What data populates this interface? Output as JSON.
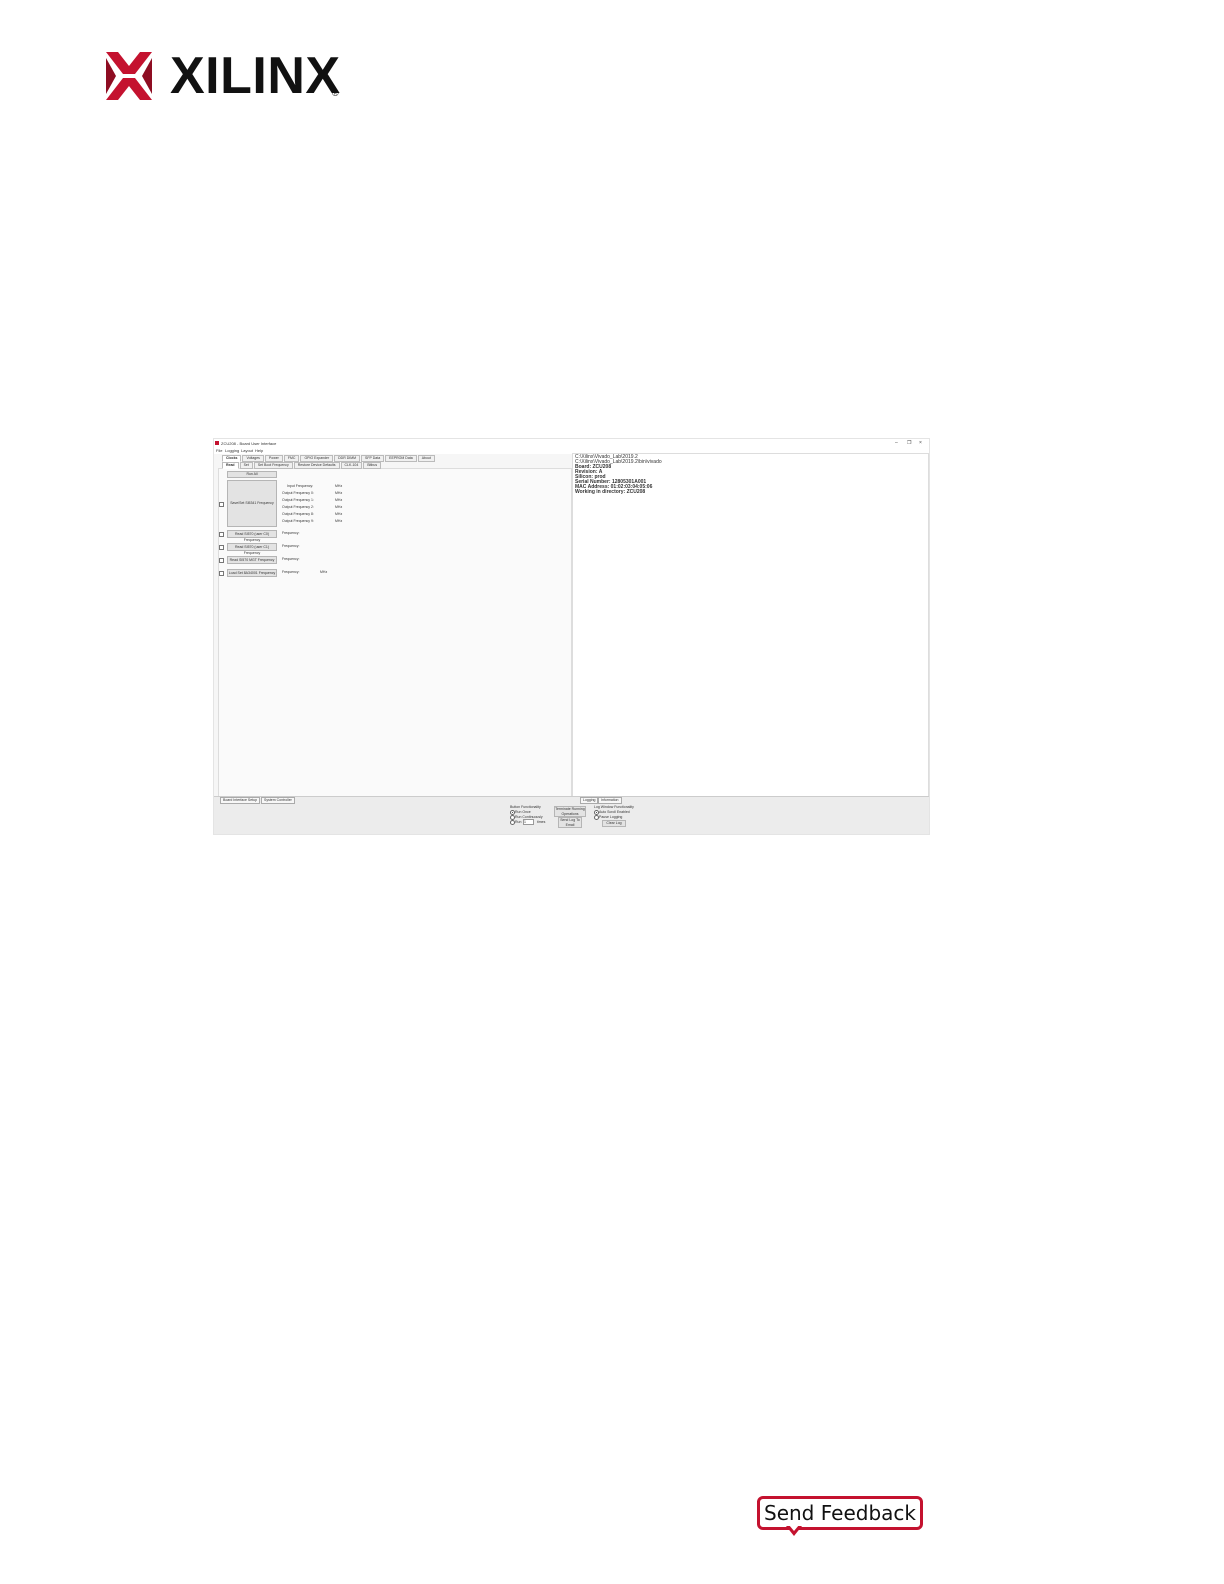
{
  "brand": {
    "name": "XILINX",
    "registered": "®",
    "color": "#c4122f"
  },
  "window": {
    "title": "ZCU208 - Board User Interface",
    "controls": [
      "–",
      "❐",
      "×"
    ],
    "menu": [
      "File",
      "Logging",
      "Layout",
      "Help"
    ],
    "tabs": [
      "Clocks",
      "Voltages",
      "Power",
      "FMC",
      "GPIO Expander",
      "DDR DIMM",
      "SFP Data",
      "EEPROM Data",
      "About"
    ],
    "subtabs": [
      "Read",
      "Set",
      "Set Boot Frequency",
      "Restore Device Defaults",
      "CLK-104",
      "Bitbus"
    ],
    "left": {
      "run_all": "Run All",
      "si5341_button": "Save/Set Si5341 Frequency",
      "si5341_rows": [
        {
          "label": "Input Frequency:",
          "unit": "MHz"
        },
        {
          "label": "Output Frequency 0:",
          "unit": "MHz"
        },
        {
          "label": "Output Frequency 1:",
          "unit": "MHz"
        },
        {
          "label": "Output Frequency 2:",
          "unit": "MHz"
        },
        {
          "label": "Output Frequency 8:",
          "unit": "MHz"
        },
        {
          "label": "Output Frequency 9:",
          "unit": "MHz"
        }
      ],
      "read_rows": [
        {
          "button": "Read SI570 (user C0) Frequency",
          "label": "Frequency:",
          "unit": ""
        },
        {
          "button": "Read SI570 (user C1) Frequency",
          "label": "Frequency:",
          "unit": ""
        },
        {
          "button": "Read SI570 MGT Frequency",
          "label": "Frequency:",
          "unit": ""
        },
        {
          "button": "Load Set 8A34001 Frequency",
          "label": "Frequency:",
          "unit": "MHz"
        }
      ]
    },
    "console": [
      {
        "text": "C:\\Xilinx\\Vivado_Lab\\2019.2",
        "bold": false
      },
      {
        "text": "C:\\Xilinx\\Vivado_Lab\\2019.2\\bin\\vivado",
        "bold": false
      },
      {
        "text": "Board: ZCU208",
        "bold": true
      },
      {
        "text": "Revision: A",
        "bold": true
      },
      {
        "text": "Silicon: prod",
        "bold": true
      },
      {
        "text": "Serial Number: 12805301A001",
        "bold": true
      },
      {
        "text": "MAC Address: 01:02:03:04:05:06",
        "bold": true
      },
      {
        "text": "Working in directory: ZCU208",
        "bold": true
      }
    ],
    "bottom": {
      "left_tabs": [
        "Board Interface Setup",
        "System Controller"
      ],
      "right_tabs": [
        "Logging",
        "Information"
      ],
      "button_functionality": "Button Functionality",
      "run_once": "Run Once",
      "run_continuously": "Run Continuously",
      "run_count_prefix": "Run",
      "run_count_value": "1",
      "run_count_suffix": "times",
      "terminate_btn": "Terminate Running Operations",
      "send_log_btn": "Send Log To Email",
      "log_window": "Log Window Functionality",
      "auto_scroll": "Auto Scroll Enabled",
      "pause_logging": "Pause Logging",
      "clear_log": "Clear Log"
    }
  },
  "feedback": {
    "label": "Send Feedback",
    "color": "#c4122f"
  }
}
